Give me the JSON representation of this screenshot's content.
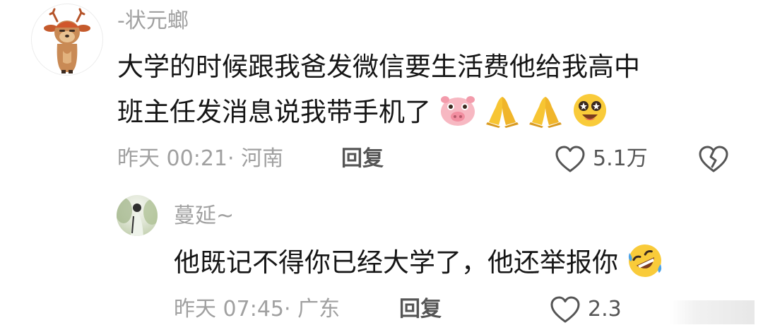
{
  "comments": [
    {
      "username": "-状元螂",
      "text_line1": "大学的时候跟我爸发微信要生活费他给我高中",
      "text_line2": "班主任发消息说我带手机了",
      "emojis": [
        "pig-face",
        "praying-hands",
        "praying-hands",
        "star-struck-face"
      ],
      "time_location": "昨天 00:21· 河南",
      "reply_label": "回复",
      "likes": "5.1万"
    }
  ],
  "replies": [
    {
      "username": "蔓延~",
      "text": "他既记不得你已经大学了，他还举报你",
      "emojis": [
        "rolling-laughing-face"
      ],
      "time_location": "昨天 07:45· 广东",
      "reply_label": "回复",
      "likes": "2.3"
    }
  ],
  "colors": {
    "meta_gray": "#a0a0a0",
    "text_black": "#161616",
    "icon_gray": "#555555"
  }
}
